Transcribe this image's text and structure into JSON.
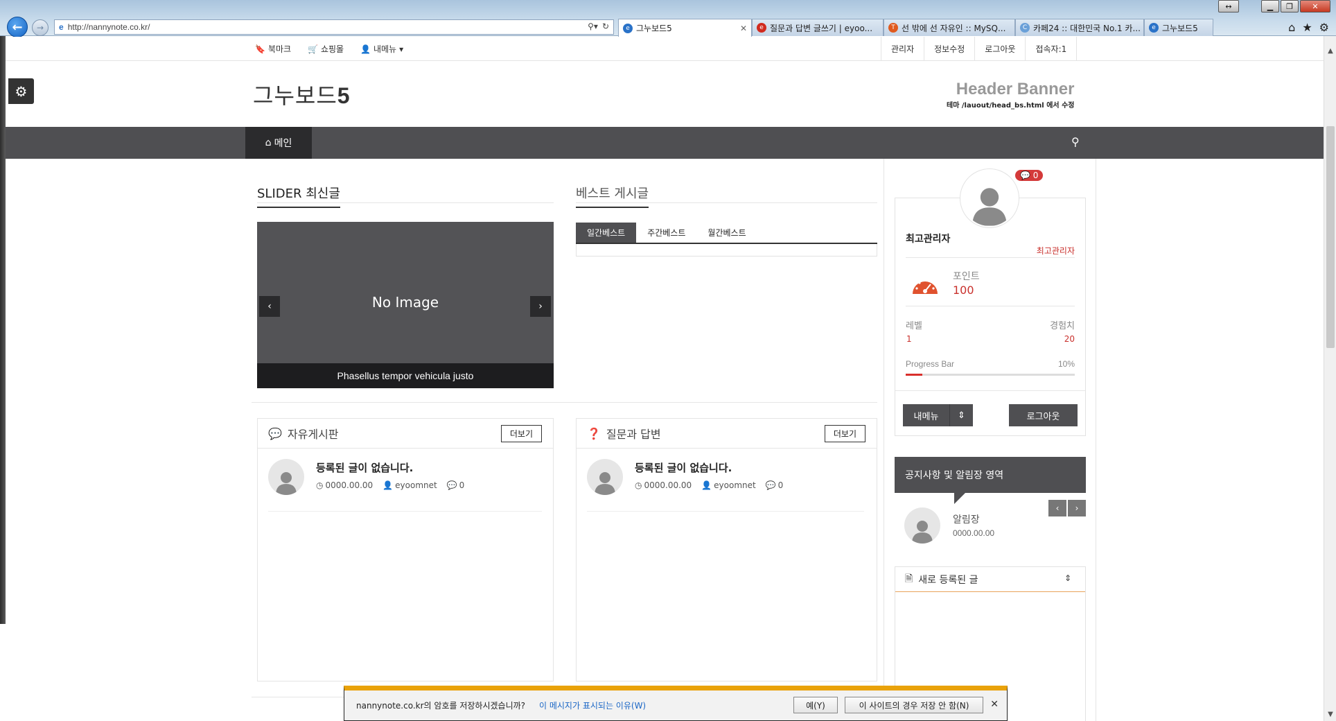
{
  "browser": {
    "url": "http://nannynote.co.kr/",
    "tabs": [
      {
        "title": "그누보드5",
        "active": true
      },
      {
        "title": "질문과 답변 글쓰기 | eyoo..."
      },
      {
        "title": "선 밖에 선 자유인 :: MySQ..."
      },
      {
        "title": "카페24 :: 대한민국 No.1 카..."
      },
      {
        "title": "그누보드5"
      }
    ]
  },
  "topbar": {
    "bookmark": "북마크",
    "shop": "쇼핑몰",
    "mymenu": "내메뉴",
    "admin": "관리자",
    "edit": "정보수정",
    "logout": "로그아웃",
    "visitors": "접속자:1"
  },
  "header": {
    "logo_prefix": "그누보드",
    "logo_num": "5",
    "banner_title": "Header Banner",
    "banner_sub": "테마 /lauout/head_bs.html 에서 수정"
  },
  "nav": {
    "home": "메인"
  },
  "slider_section": {
    "title": "SLIDER 최신글",
    "no_image": "No Image",
    "caption": "Phasellus tempor vehicula justo"
  },
  "best_section": {
    "title": "베스트 게시글",
    "tabs": [
      "일간베스트",
      "주간베스트",
      "월간베스트"
    ]
  },
  "boards": [
    {
      "title": "자유게시판",
      "more": "더보기",
      "post_title": "등록된 글이 없습니다.",
      "date": "0000.00.00",
      "author": "eyoomnet",
      "comments": "0"
    },
    {
      "title": "질문과 답변",
      "more": "더보기",
      "post_title": "등록된 글이 없습니다.",
      "date": "0000.00.00",
      "author": "eyoomnet",
      "comments": "0"
    }
  ],
  "profile": {
    "messages": "0",
    "name": "최고관리자",
    "role": "최고관리자",
    "point_label": "포인트",
    "point_value": "100",
    "level_label": "레벨",
    "level_value": "1",
    "exp_label": "경험치",
    "exp_value": "20",
    "progress_label": "Progress Bar",
    "progress_pct": "10%",
    "progress_value": 0.1,
    "mymenu_btn": "내메뉴",
    "logout_btn": "로그아웃"
  },
  "notice": {
    "title": "공지사항 및 알림장 영역",
    "item_title": "알림장",
    "item_date": "0000.00.00"
  },
  "newposts": {
    "title": "새로 등록된 글"
  },
  "password_bar": {
    "question": "nannynote.co.kr의 암호를 저장하시겠습니까?",
    "why_link": "이 메시지가 표시되는 이유(W)",
    "yes": "예(Y)",
    "never": "이 사이트의 경우 저장 안 함(N)"
  },
  "colors": {
    "nav_bg": "#4f4f52",
    "nav_active": "#2b2b2d",
    "accent_red": "#c9302c",
    "pw_bar_top": "#e9a20a"
  }
}
